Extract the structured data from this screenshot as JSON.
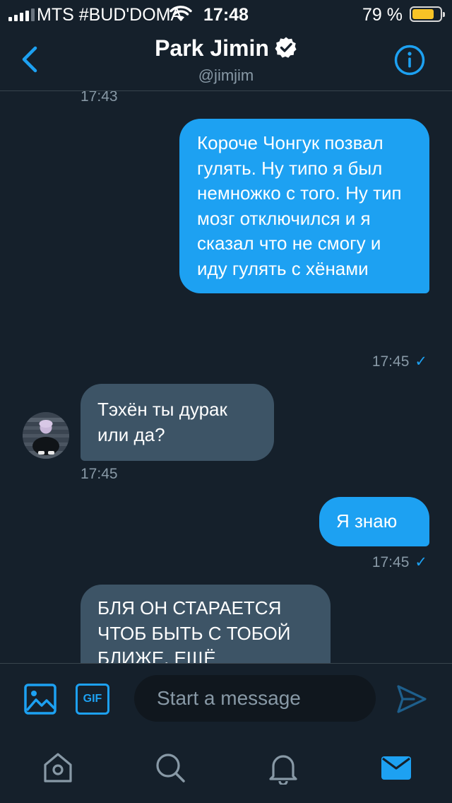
{
  "status_bar": {
    "carrier": "MTS #BUD'DOMA",
    "time": "17:48",
    "battery": "79 %",
    "battery_level": 0.79
  },
  "header": {
    "name": "Park Jimin",
    "handle": "@jimjim"
  },
  "messages": [
    {
      "timestamp": "17:43"
    },
    {
      "direction": "sent",
      "text": "Короче Чонгук позвал гулять. Ну типо я был немножко с того. Ну тип мозг отключился и я сказал что не смогу и иду гулять с хёнами",
      "timestamp": "17:45",
      "check": "✓"
    },
    {
      "direction": "received",
      "text": "Тэхён ты дурак или да?",
      "timestamp": "17:45"
    },
    {
      "direction": "sent",
      "text": "Я знаю",
      "timestamp": "17:45",
      "check": "✓"
    },
    {
      "direction": "received",
      "text": "БЛЯ ОН СТАРАЕТСЯ ЧТОБ БЫТЬ С ТОБОЙ БЛИЖЕ. ЕЩЁ"
    }
  ],
  "composer": {
    "gif_label": "GIF",
    "placeholder": "Start a message"
  },
  "colors": {
    "background": "#15202b",
    "accent": "#1da1f2",
    "received_bubble": "#3d5466",
    "muted_text": "#8899a6",
    "battery": "#f7c326"
  }
}
